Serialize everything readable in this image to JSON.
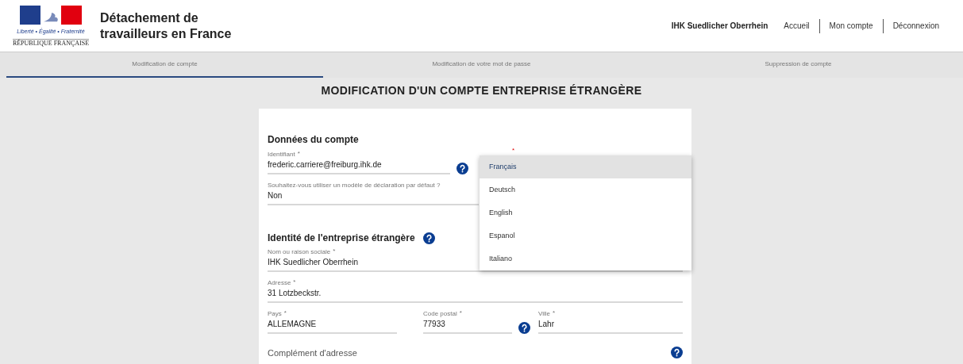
{
  "header": {
    "logo": {
      "motto": "Liberté • Égalité • Fraternité",
      "country": "RÉPUBLIQUE FRANÇAISE"
    },
    "site_title": "Détachement de travailleurs en France",
    "user": "IHK Suedlicher Oberrhein",
    "links": [
      "Accueil",
      "Mon compte",
      "Déconnexion"
    ]
  },
  "tabs": [
    {
      "label": "Modification de compte",
      "selected": true
    },
    {
      "label": "Modification de votre mot de passe",
      "selected": false
    },
    {
      "label": "Suppression de compte",
      "selected": false
    }
  ],
  "page_title": "MODIFICATION D'UN COMPTE ENTREPRISE ÉTRANGÈRE",
  "account": {
    "heading": "Données du compte",
    "identifier": {
      "label": "Identifiant",
      "required_mark": "*",
      "value": "frederic.carriere@freiburg.ihk.de",
      "help": true
    },
    "template": {
      "label": "Souhaitez-vous utiliser un modèle de déclaration par défaut ?",
      "value": "Non",
      "help": false
    }
  },
  "language_dropdown": {
    "required_mark": "*",
    "options": [
      {
        "label": "Français",
        "selected": true
      },
      {
        "label": "Deutsch",
        "selected": false
      },
      {
        "label": "English",
        "selected": false
      },
      {
        "label": "Espanol",
        "selected": false
      },
      {
        "label": "Italiano",
        "selected": false
      }
    ]
  },
  "company": {
    "heading": "Identité de l'entreprise étrangère",
    "fields": [
      {
        "label": "Nom ou raison sociale",
        "required_mark": "*",
        "value": "IHK Suedlicher Oberrhein",
        "help": false
      },
      {
        "label": "Adresse",
        "required_mark": "*",
        "value": "31 Lotzbeckstr.",
        "help": false
      },
      {
        "label": "Pays",
        "required_mark": "*",
        "value": "ALLEMAGNE",
        "help": false
      },
      {
        "label": "Code postal",
        "required_mark": "*",
        "value": "77933",
        "help": true
      },
      {
        "label": "Ville",
        "required_mark": "*",
        "value": "Lahr",
        "help": false
      },
      {
        "label": "Complément d'adresse",
        "help": true
      }
    ]
  }
}
